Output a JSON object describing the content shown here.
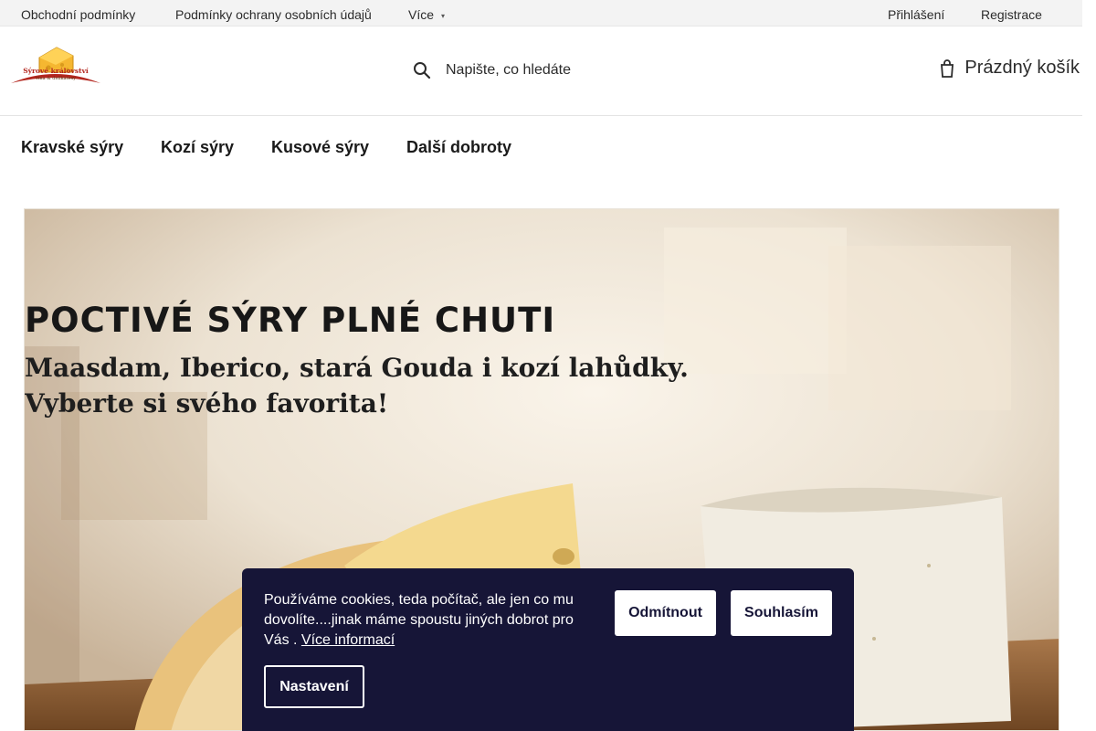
{
  "topbar": {
    "links": [
      "Obchodní podmínky",
      "Podmínky ochrany osobních údajů",
      "Více"
    ],
    "account": {
      "login": "Přihlášení",
      "register": "Registrace"
    }
  },
  "header": {
    "logo": {
      "line1": "Sýrové království",
      "line2": "vína & delikatesy"
    },
    "search_placeholder": "Napište, co hledáte",
    "search_icon": "search-icon",
    "cart_label": "Prázdný košík",
    "cart_icon": "cart-icon"
  },
  "nav": {
    "items": [
      "Kravské sýry",
      "Kozí sýry",
      "Kusové sýry",
      "Další dobroty"
    ]
  },
  "banner": {
    "headline": "POCTIVÉ SÝRY PLNÉ CHUTI",
    "subline1": "Maasdam, Iberico, stará Gouda i kozí lahůdky.",
    "subline2": "Vyberte si svého favorita!"
  },
  "cookie": {
    "text": "Používáme cookies, teda počítač, ale jen co mu dovolíte....jinak máme spoustu jiných dobrot pro Vás .",
    "more_link": "Více informací",
    "decline": "Odmítnout",
    "accept": "Souhlasím",
    "settings": "Nastavení"
  },
  "colors": {
    "cookie_bg": "#161537",
    "topbar_bg": "#f3f3f3",
    "logo_red": "#b3261e",
    "logo_yellow": "#f5b731"
  }
}
